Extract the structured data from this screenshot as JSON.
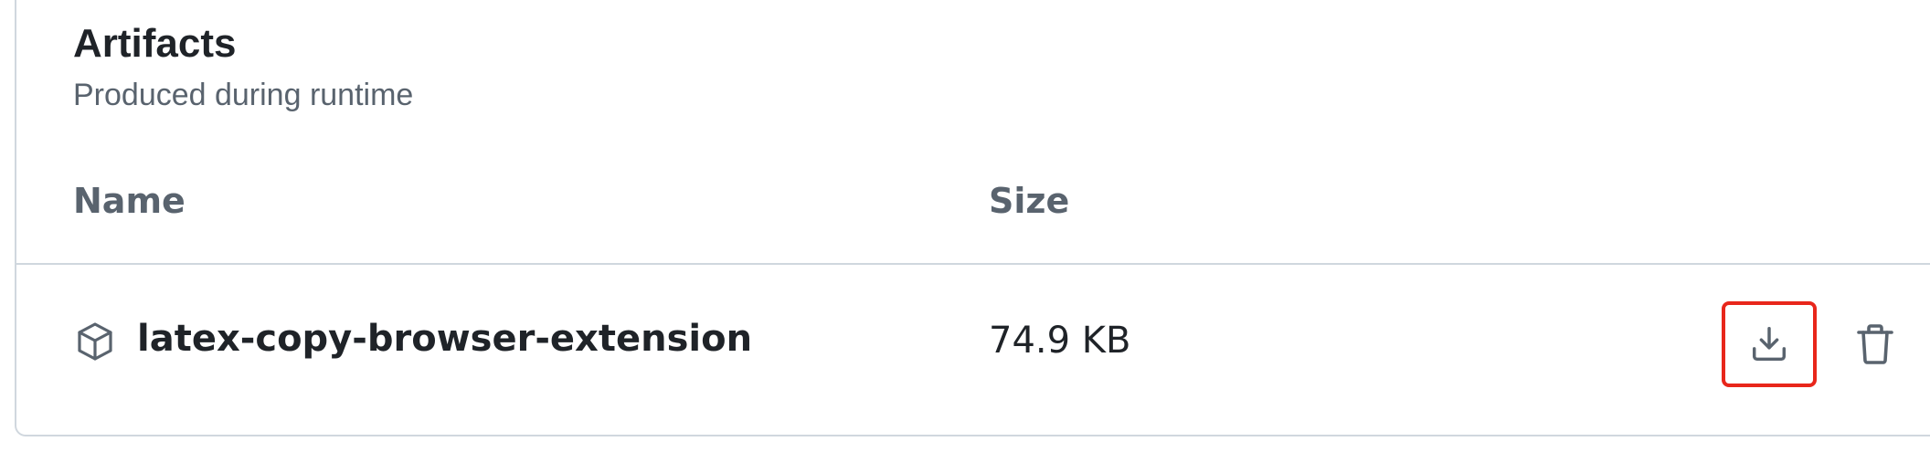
{
  "section": {
    "title": "Artifacts",
    "subtitle": "Produced during runtime"
  },
  "table": {
    "columns": [
      "Name",
      "Size"
    ],
    "rows": [
      {
        "name": "latex-copy-browser-extension",
        "size": "74.9 KB",
        "icon": "package-icon",
        "actions": [
          "download-icon",
          "trash-icon"
        ]
      }
    ]
  },
  "colors": {
    "text_primary": "#1f2328",
    "text_muted": "#59636e",
    "border": "#d0d7de",
    "highlight": "#e8261b"
  }
}
